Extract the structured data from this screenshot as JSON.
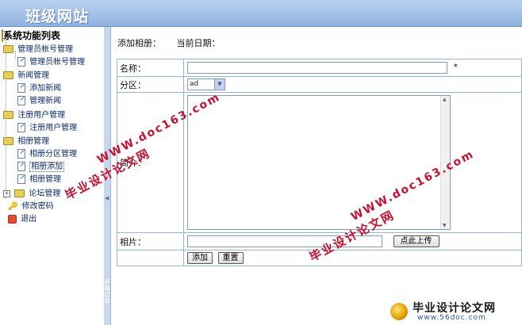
{
  "header": {
    "site_title": "班级网站"
  },
  "sidebar": {
    "root_label": "系统功能列表",
    "items": [
      {
        "label": "管理员帐号管理",
        "type": "folder"
      },
      {
        "label": "管理员帐号管理",
        "type": "link"
      },
      {
        "label": "新闻管理",
        "type": "folder"
      },
      {
        "label": "添加新闻",
        "type": "link"
      },
      {
        "label": "管理新闻",
        "type": "link"
      },
      {
        "label": "注册用户管理",
        "type": "folder"
      },
      {
        "label": "注册用户管理",
        "type": "link"
      },
      {
        "label": "相册管理",
        "type": "folder"
      },
      {
        "label": "相册分区管理",
        "type": "link"
      },
      {
        "label": "相册添加",
        "type": "link",
        "selected": true
      },
      {
        "label": "相册管理",
        "type": "link"
      },
      {
        "label": "论坛管理",
        "type": "folder-collapsed"
      },
      {
        "label": "修改密码",
        "type": "key"
      },
      {
        "label": "退出",
        "type": "exit"
      }
    ]
  },
  "splitter": {
    "toggle_text": "屏幕切换"
  },
  "main": {
    "heading": "添加相册：",
    "date_label": "当前日期：",
    "form": {
      "name_label": "名称：",
      "name_value": "",
      "required_mark": "*",
      "section_label": "分区：",
      "section_selected": "ad",
      "intro_label": "简介：",
      "intro_value": "",
      "photo_label": "相片：",
      "photo_value": "",
      "upload_button": "点此上传",
      "add_button": "添加",
      "reset_button": "重置"
    }
  },
  "watermarks": {
    "cn_text": "毕业设计论文网",
    "en_text": "WWW.doc163.com",
    "logo_cn": "毕业设计论文网",
    "logo_url": "www.56doc.com"
  },
  "colors": {
    "header_top": "#b9d1ef",
    "header_bottom": "#8fb2e0",
    "table_border": "#8eb7e6",
    "watermark_red": "#c8102e"
  }
}
